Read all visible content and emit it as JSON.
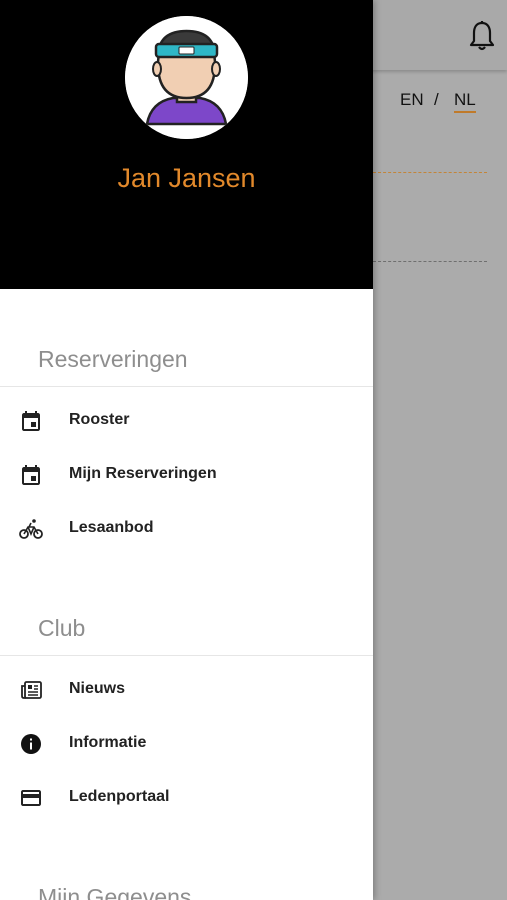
{
  "background": {
    "language": {
      "en": "EN",
      "separator": "/",
      "nl": "NL"
    }
  },
  "drawer": {
    "user": {
      "name": "Jan Jansen"
    },
    "sections": [
      {
        "title": "Reserveringen",
        "items": [
          {
            "label": "Rooster",
            "icon": "calendar-icon"
          },
          {
            "label": "Mijn Reserveringen",
            "icon": "calendar-icon"
          },
          {
            "label": "Lesaanbod",
            "icon": "bicycle-icon"
          }
        ]
      },
      {
        "title": "Club",
        "items": [
          {
            "label": "Nieuws",
            "icon": "newspaper-icon"
          },
          {
            "label": "Informatie",
            "icon": "info-icon"
          },
          {
            "label": "Ledenportaal",
            "icon": "credit-card-icon"
          }
        ]
      },
      {
        "title": "Mijn Gegevens",
        "items": []
      }
    ]
  },
  "colors": {
    "accent": "#e2892b",
    "header_bg": "#000000",
    "overlay": "#ababab"
  }
}
